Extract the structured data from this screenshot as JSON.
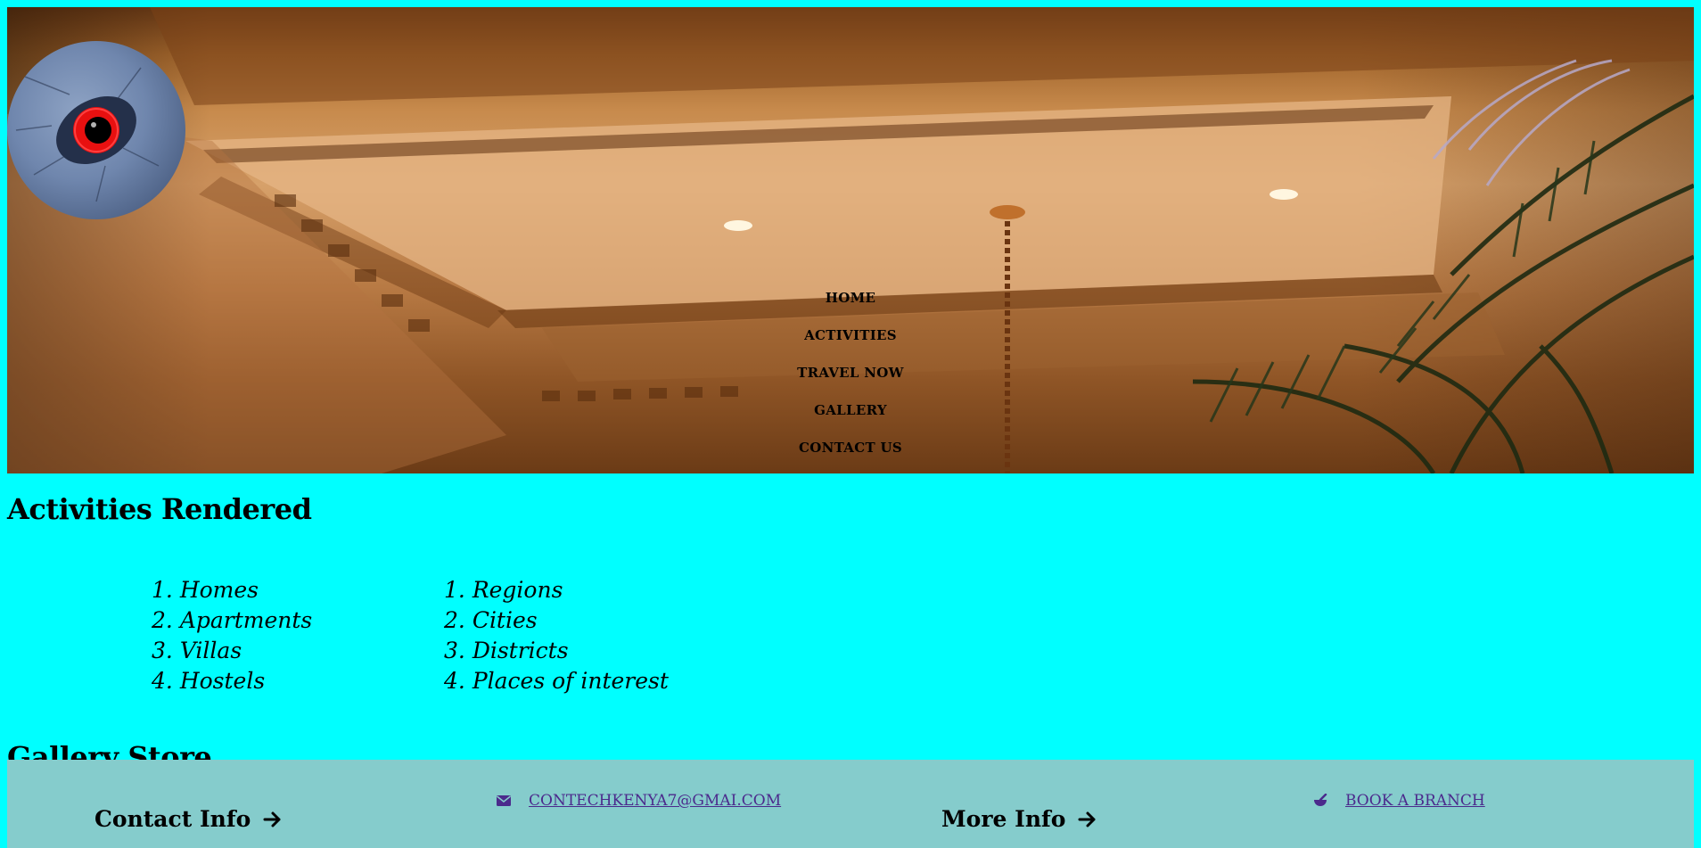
{
  "nav": {
    "items": [
      "HOME",
      "ACTIVITIES",
      "TRAVEL NOW",
      "GALLERY",
      "CONTACT US"
    ]
  },
  "activities": {
    "title": "Activities Rendered",
    "list_a": [
      "Homes",
      "Apartments",
      "Villas",
      "Hostels"
    ],
    "list_b": [
      "Regions",
      "Cities",
      "Districts",
      "Places of interest"
    ]
  },
  "gallery": {
    "title": "Gallery Store"
  },
  "footer": {
    "contact_title": "Contact Info",
    "more_title": "More Info",
    "email": "CONTECHKENYA7@GMAI.COM",
    "book_branch": "BOOK A BRANCH",
    "link_color": "#4b2a8c",
    "background": "#85cccc"
  },
  "colors": {
    "page_background": "#00ffff",
    "text": "#000000"
  },
  "icons": [
    "bird-eye-logo",
    "arrow-right-icon",
    "envelope-icon",
    "mortar-pestle-icon"
  ]
}
